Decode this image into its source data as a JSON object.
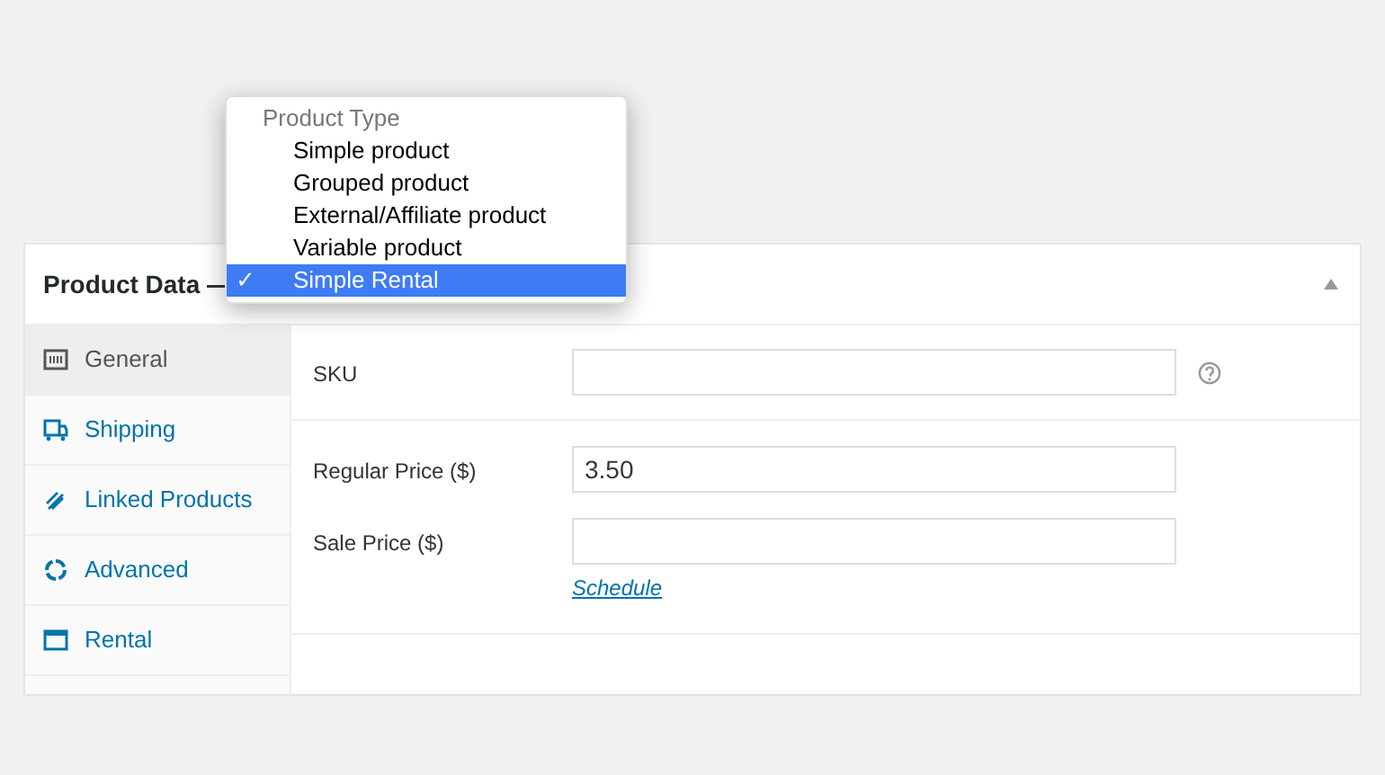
{
  "panel": {
    "title": "Product Data —",
    "collapsed": false
  },
  "product_type_menu": {
    "heading": "Product Type",
    "check": "✓",
    "options": [
      {
        "label": "Simple product",
        "selected": false
      },
      {
        "label": "Grouped product",
        "selected": false
      },
      {
        "label": "External/Affiliate product",
        "selected": false
      },
      {
        "label": "Variable product",
        "selected": false
      },
      {
        "label": "Simple Rental",
        "selected": true
      }
    ]
  },
  "tabs": [
    {
      "label": "General",
      "kind": "general",
      "selected": true
    },
    {
      "label": "Shipping",
      "kind": "shipping",
      "selected": false
    },
    {
      "label": "Linked Products",
      "kind": "linked",
      "selected": false
    },
    {
      "label": "Advanced",
      "kind": "advanced",
      "selected": false
    },
    {
      "label": "Rental",
      "kind": "rental",
      "selected": false
    }
  ],
  "sections": [
    {
      "fields": [
        {
          "label": "SKU",
          "help": true
        }
      ]
    },
    {
      "fields": [
        {
          "label": "Regular Price ($)",
          "value": "3.50"
        },
        {
          "label": "Sale Price ($)",
          "link": "Schedule"
        }
      ]
    }
  ]
}
